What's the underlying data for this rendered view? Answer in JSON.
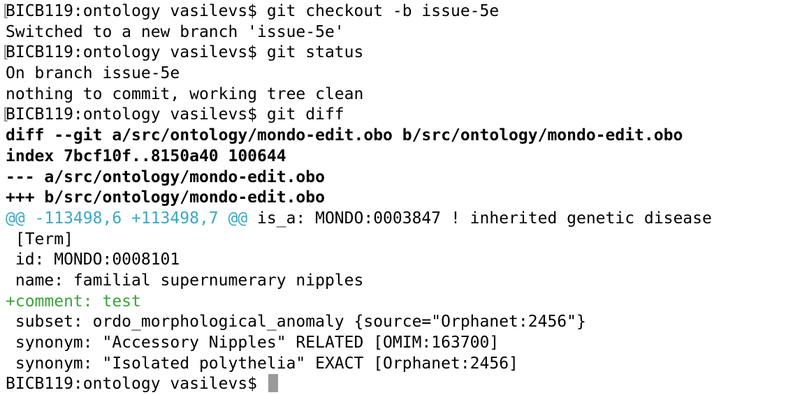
{
  "terminal": {
    "lines": [
      {
        "type": "prompt",
        "bracket": "[",
        "prompt": "BICB119:ontology vasilevs$ ",
        "command": "git checkout -b issue-5e"
      },
      {
        "type": "output",
        "text": "Switched to a new branch 'issue-5e'"
      },
      {
        "type": "prompt",
        "bracket": "[",
        "prompt": "BICB119:ontology vasilevs$ ",
        "command": "git status"
      },
      {
        "type": "output",
        "text": "On branch issue-5e"
      },
      {
        "type": "output",
        "text": "nothing to commit, working tree clean"
      },
      {
        "type": "prompt",
        "bracket": "[",
        "prompt": "BICB119:ontology vasilevs$ ",
        "command": "git diff"
      },
      {
        "type": "diff-header",
        "text": "diff --git a/src/ontology/mondo-edit.obo b/src/ontology/mondo-edit.obo"
      },
      {
        "type": "diff-header",
        "text": "index 7bcf10f..8150a40 100644"
      },
      {
        "type": "diff-header",
        "text": "--- a/src/ontology/mondo-edit.obo"
      },
      {
        "type": "diff-header",
        "text": "+++ b/src/ontology/mondo-edit.obo"
      },
      {
        "type": "hunk",
        "hunk": "@@ -113498,6 +113498,7 @@",
        "context": " is_a: MONDO:0003847 ! inherited genetic disease"
      },
      {
        "type": "context",
        "text": " [Term]"
      },
      {
        "type": "context",
        "text": " id: MONDO:0008101"
      },
      {
        "type": "context",
        "text": " name: familial supernumerary nipples"
      },
      {
        "type": "added",
        "text": "+comment: test"
      },
      {
        "type": "context",
        "text": " subset: ordo_morphological_anomaly {source=\"Orphanet:2456\"}"
      },
      {
        "type": "context",
        "text": " synonym: \"Accessory Nipples\" RELATED [OMIM:163700]"
      },
      {
        "type": "context",
        "text": " synonym: \"Isolated polythelia\" EXACT [Orphanet:2456]"
      },
      {
        "type": "final-prompt",
        "prompt": "BICB119:ontology vasilevs$ "
      }
    ]
  }
}
